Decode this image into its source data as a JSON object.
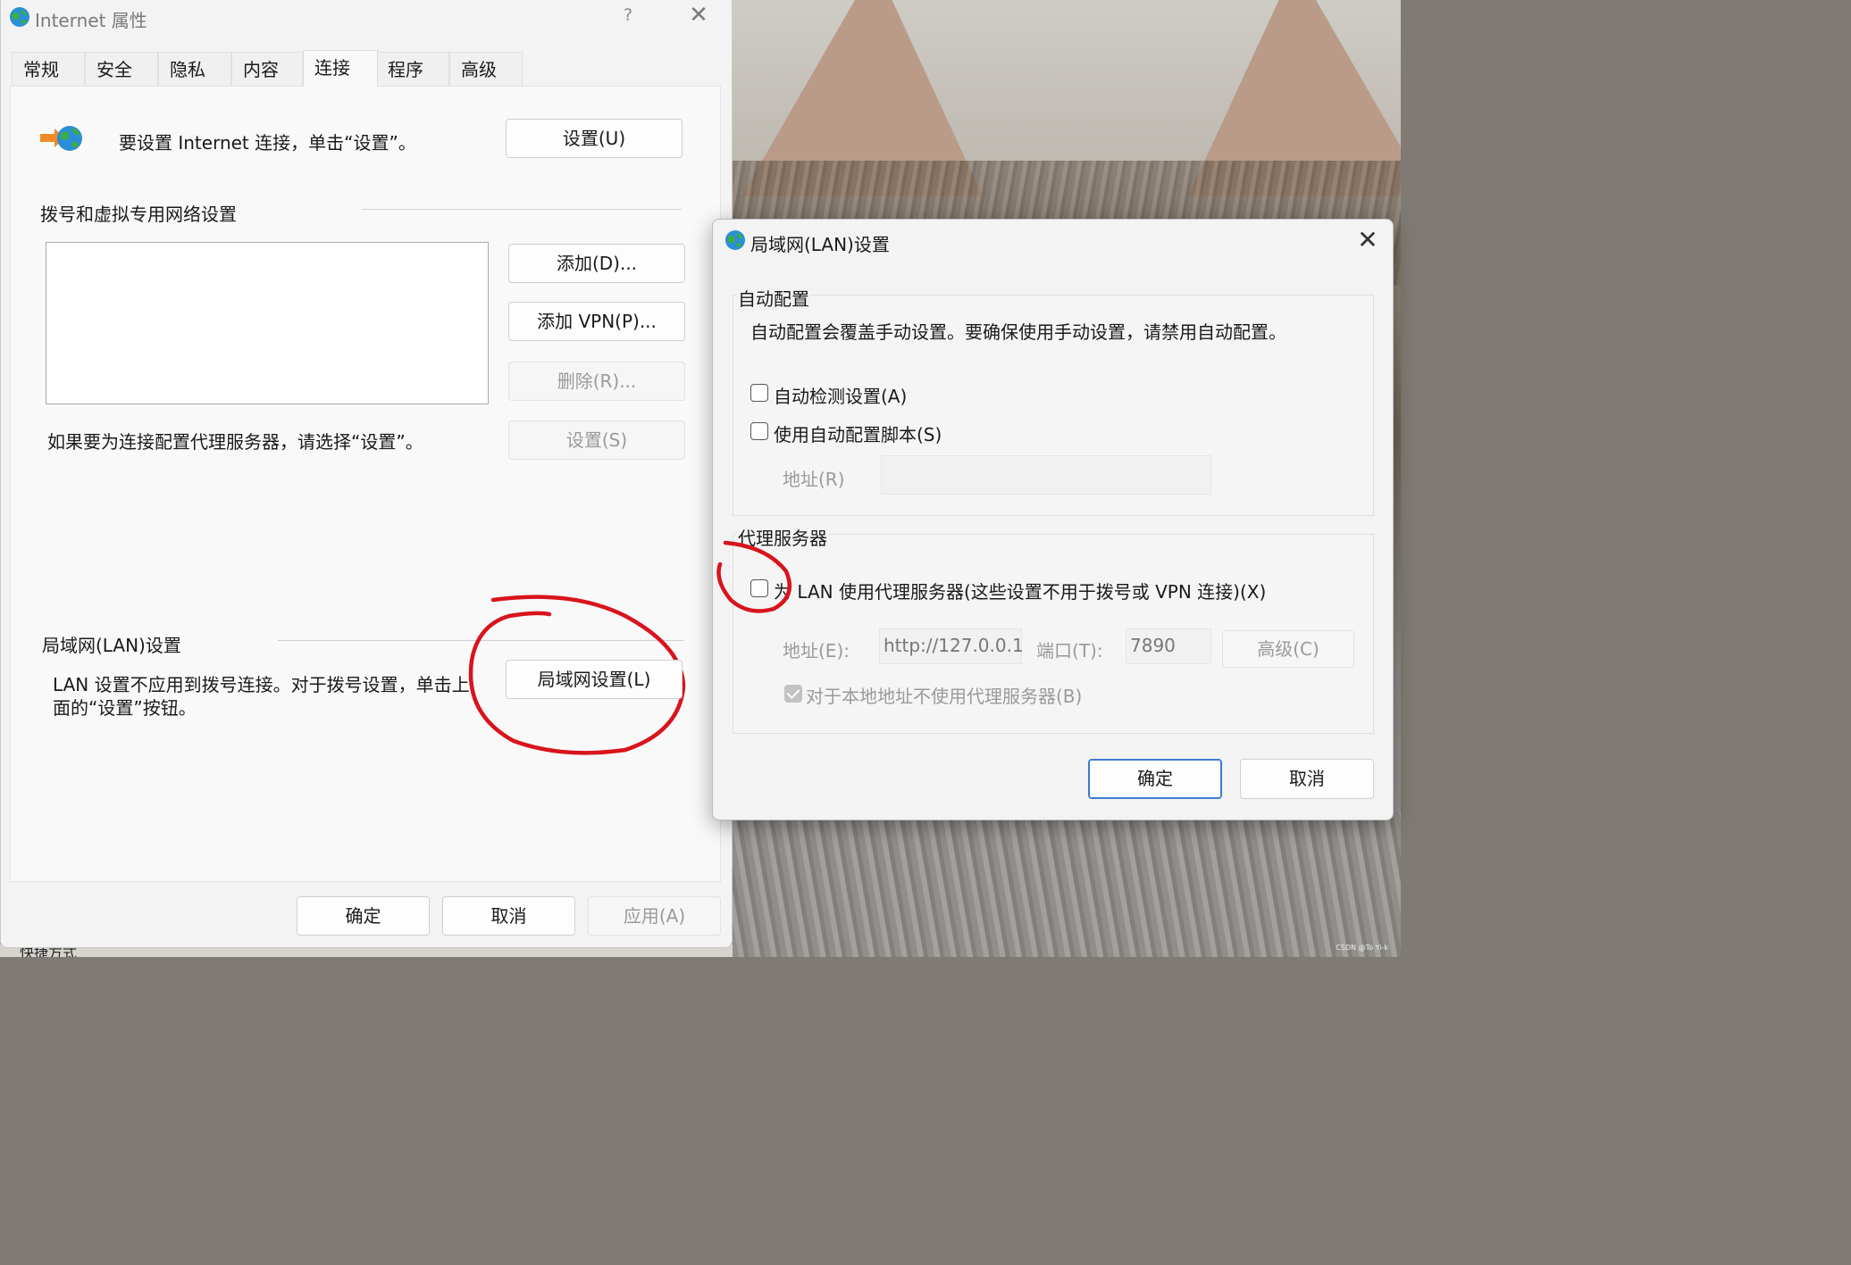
{
  "window": {
    "title": "Internet 属性",
    "help_glyph": "?",
    "close_glyph": "✕"
  },
  "tabs": [
    {
      "label": "常规"
    },
    {
      "label": "安全"
    },
    {
      "label": "隐私"
    },
    {
      "label": "内容"
    },
    {
      "label": "连接",
      "active": true
    },
    {
      "label": "程序"
    },
    {
      "label": "高级"
    }
  ],
  "connections": {
    "setup_text": "要设置 Internet 连接，单击“设置”。",
    "setup_button": "设置(U)",
    "dialup_section": "拨号和虚拟专用网络设置",
    "add_button": "添加(D)...",
    "add_vpn_button": "添加 VPN(P)...",
    "remove_button": "删除(R)...",
    "settings_button": "设置(S)",
    "proxy_hint": "如果要为连接配置代理服务器，请选择“设置”。",
    "lan_section": "局域网(LAN)设置",
    "lan_text_line1": "LAN 设置不应用到拨号连接。对于拨号设置，单击上",
    "lan_text_line2": "面的“设置”按钮。",
    "lan_button": "局域网设置(L)"
  },
  "footer": {
    "ok": "确定",
    "cancel": "取消",
    "apply": "应用(A)"
  },
  "lan_dialog": {
    "title": "局域网(LAN)设置",
    "close_glyph": "✕",
    "auto_group": "自动配置",
    "auto_desc": "自动配置会覆盖手动设置。要确保使用手动设置，请禁用自动配置。",
    "auto_detect": "自动检测设置(A)",
    "auto_detect_checked": false,
    "auto_script": "使用自动配置脚本(S)",
    "auto_script_checked": false,
    "script_address_label": "地址(R)",
    "script_address_value": "",
    "proxy_group": "代理服务器",
    "use_proxy": "为 LAN 使用代理服务器(这些设置不用于拨号或 VPN 连接)(X)",
    "use_proxy_checked": false,
    "address_label": "地址(E):",
    "address_value": "http://127.0.0.1",
    "port_label": "端口(T):",
    "port_value": "7890",
    "advanced_button": "高级(C)",
    "bypass_local": "对于本地地址不使用代理服务器(B)",
    "bypass_local_checked": true,
    "ok": "确定",
    "cancel": "取消"
  },
  "background": {
    "taskbar_text": "快捷方式",
    "watermark": "CSDN @To Yi-k"
  },
  "annotation_color": "#d8141c"
}
